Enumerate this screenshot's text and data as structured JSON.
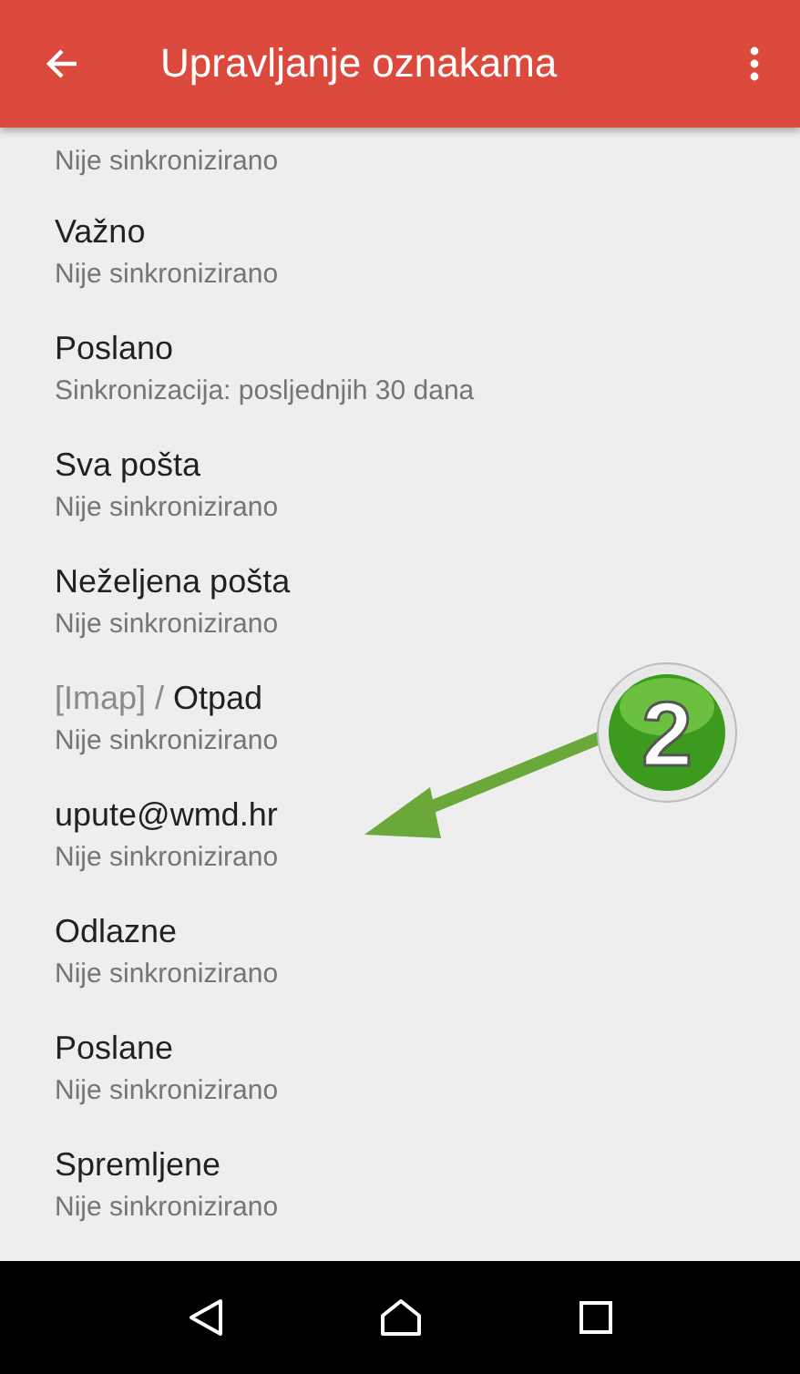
{
  "app_bar": {
    "title": "Upravljanje oznakama"
  },
  "labels": [
    {
      "subtitle": "Nije sinkronizirano"
    },
    {
      "title": "Važno",
      "subtitle": "Nije sinkronizirano"
    },
    {
      "title": "Poslano",
      "subtitle": "Sinkronizacija: posljednjih 30 dana"
    },
    {
      "title": "Sva pošta",
      "subtitle": "Nije sinkronizirano"
    },
    {
      "title": "Neželjena pošta",
      "subtitle": "Nije sinkronizirano"
    },
    {
      "prefix": "[Imap] /",
      "title": "Otpad",
      "subtitle": "Nije sinkronizirano"
    },
    {
      "title": "upute@wmd.hr",
      "subtitle": "Nije sinkronizirano"
    },
    {
      "title": "Odlazne",
      "subtitle": "Nije sinkronizirano"
    },
    {
      "title": "Poslane",
      "subtitle": "Nije sinkronizirano"
    },
    {
      "title": "Spremljene",
      "subtitle": "Nije sinkronizirano"
    }
  ],
  "annotation": {
    "number": "2"
  }
}
